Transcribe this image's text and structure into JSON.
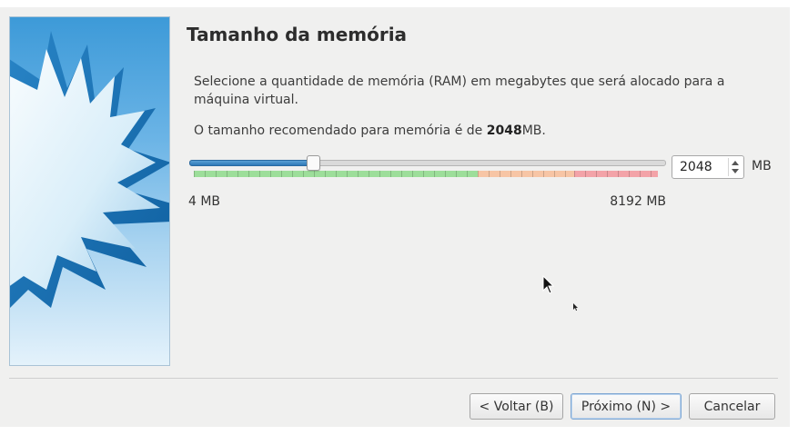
{
  "dialog": {
    "title": "Tamanho da memória",
    "description": "Selecione a quantidade de memória (RAM) em megabytes que será alocado para a máquina virtual.",
    "recommendation": {
      "prefix": "O tamanho recomendado para memória é de ",
      "value": "2048",
      "suffix": "MB."
    }
  },
  "memory": {
    "min_label": "4 MB",
    "max_label": "8192 MB",
    "min": 4,
    "max": 8192,
    "value": 2048,
    "value_text": "2048",
    "unit": "MB",
    "zones": [
      {
        "name": "green",
        "color": "#9dde9a"
      },
      {
        "name": "orange",
        "color": "#f7c5a5"
      },
      {
        "name": "red",
        "color": "#f3a3a8"
      }
    ],
    "accent": "#2f79b8"
  },
  "buttons": {
    "back": "< Voltar (B)",
    "next": "Próximo (N) >",
    "cancel": "Cancelar"
  }
}
